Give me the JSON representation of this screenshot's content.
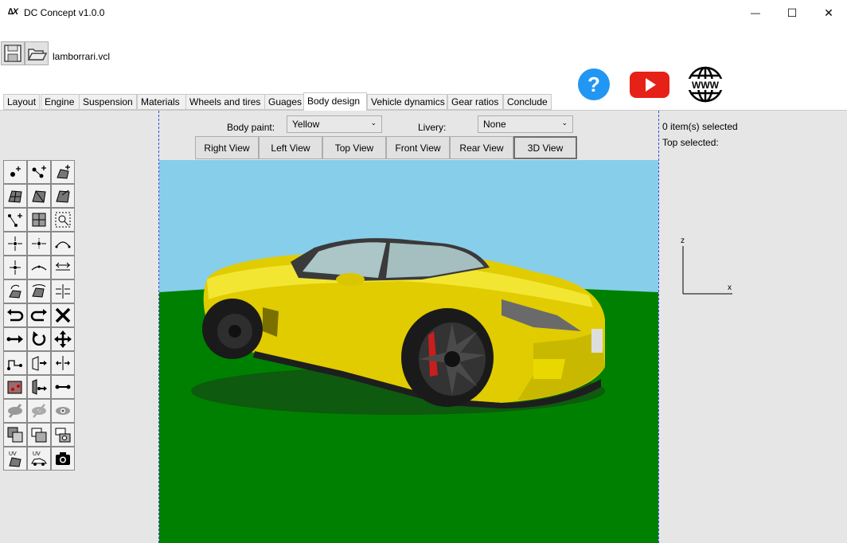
{
  "window": {
    "logo_text": "∆X",
    "title": "DC Concept v1.0.0",
    "minimize_glyph": "—",
    "maximize_glyph": "☐",
    "close_glyph": "✕"
  },
  "toolbar": {
    "save_icon": "floppy-disk-icon",
    "open_icon": "open-folder-icon",
    "filename": "lamborrari.vcl"
  },
  "links": {
    "help_icon": "help-icon",
    "help_glyph": "?",
    "youtube_icon": "youtube-icon",
    "web_icon": "www-globe-icon",
    "web_text": "WWW"
  },
  "tabs": [
    {
      "label": "Layout"
    },
    {
      "label": "Engine"
    },
    {
      "label": "Suspension"
    },
    {
      "label": "Materials"
    },
    {
      "label": "Wheels and tires"
    },
    {
      "label": "Guages"
    },
    {
      "label": "Body design"
    },
    {
      "label": "Vehicle dynamics"
    },
    {
      "label": "Gear ratios"
    },
    {
      "label": "Conclude"
    }
  ],
  "active_tab": "Body design",
  "body_design": {
    "paint_label": "Body paint:",
    "paint_value": "Yellow",
    "livery_label": "Livery:",
    "livery_value": "None",
    "views": [
      {
        "label": "Right View"
      },
      {
        "label": "Left View"
      },
      {
        "label": "Top View"
      },
      {
        "label": "Front View"
      },
      {
        "label": "Rear View"
      },
      {
        "label": "3D View"
      }
    ],
    "active_view": "3D View"
  },
  "selection": {
    "count_text": "0 item(s) selected",
    "top_text": "Top selected:"
  },
  "axes": {
    "z_label": "z",
    "x_label": "x"
  },
  "tool_palette": [
    "add-vertex-icon",
    "add-edge-icon",
    "add-face-icon",
    "face-grid-icon",
    "face-split-icon",
    "face-extrude-icon",
    "connect-vertices-icon",
    "grid-select-icon",
    "zoom-select-icon",
    "merge-center-icon",
    "merge-horizontal-icon",
    "curve-icon",
    "merge-vertical-icon",
    "smooth-curve-icon",
    "spread-icon",
    "rotate-face-icon",
    "flip-face-icon",
    "align-icon",
    "undo-icon",
    "redo-icon",
    "delete-icon",
    "move-horizontal-icon",
    "rotate-icon",
    "move-all-icon",
    "snap-icon",
    "mirror-icon",
    "mirror-horizontal-icon",
    "select-region-icon",
    "extend-icon",
    "stretch-icon",
    "hide-icon",
    "hide-others-icon",
    "show-icon",
    "copy-layer-icon",
    "paste-layer-icon",
    "layers-icon",
    "uv-map-icon",
    "uv-car-icon",
    "camera-icon"
  ],
  "colors": {
    "sky": "#87ceeb",
    "ground": "#008000",
    "car_body": "#e8d400",
    "help_blue": "#2196f3",
    "youtube_red": "#e62117"
  }
}
